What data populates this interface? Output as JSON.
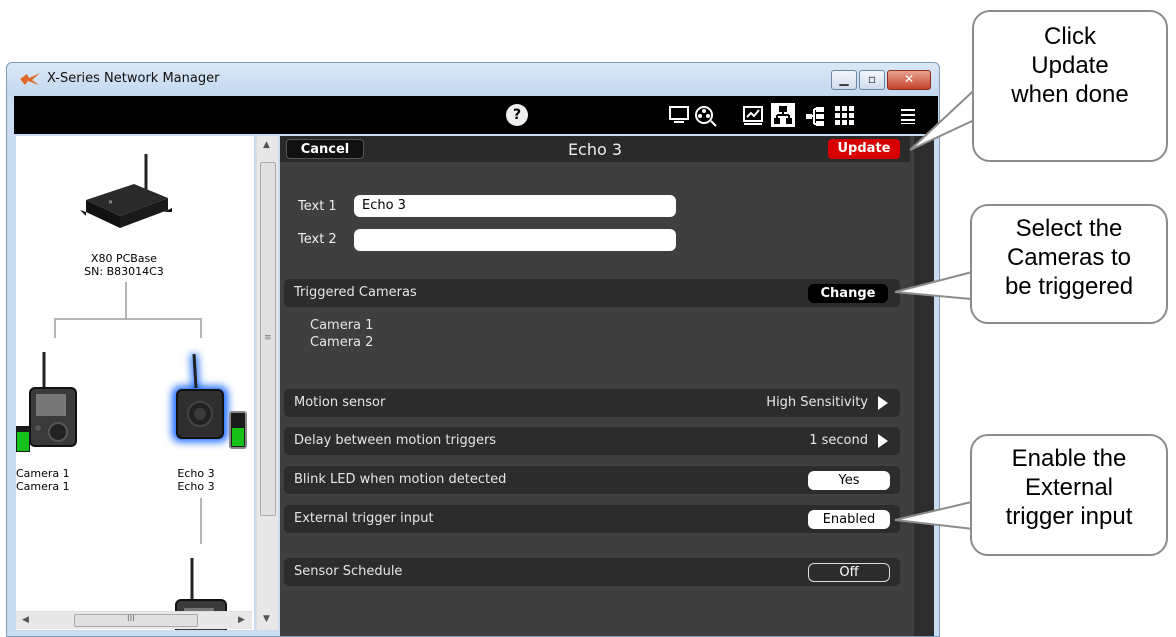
{
  "window": {
    "title": "X-Series Network Manager"
  },
  "toolbar": {
    "help_icon_glyph": "?",
    "icons": [
      "help-icon",
      "monitor-icon",
      "film-reel-icon",
      "chart-icon",
      "network-icon",
      "tree-icon",
      "grid-icon",
      "menu-icon"
    ]
  },
  "tree": {
    "base": {
      "name": "X80 PCBase",
      "serial": "SN: B83014C3"
    },
    "nodes": [
      {
        "line1": "Camera 1",
        "line2": "Camera 1"
      },
      {
        "line1": "Echo 3",
        "line2": "Echo 3"
      }
    ],
    "hscroll_label": "III"
  },
  "panel": {
    "cancel_label": "Cancel",
    "update_label": "Update",
    "title": "Echo 3",
    "text1_label": "Text 1",
    "text1_value": "Echo 3",
    "text2_label": "Text 2",
    "text2_value": "",
    "triggered_label": "Triggered Cameras",
    "change_label": "Change",
    "cameras": [
      "Camera 1",
      "Camera 2"
    ],
    "rows": [
      {
        "label": "Motion sensor",
        "value": "High Sensitivity"
      },
      {
        "label": "Delay between motion triggers",
        "value": "1 second"
      },
      {
        "label": "Blink LED when motion detected",
        "value": "Yes"
      },
      {
        "label": "External trigger input",
        "value": "Enabled"
      },
      {
        "label": "Sensor Schedule",
        "value": "Off"
      }
    ]
  },
  "callouts": {
    "update": [
      "Click",
      "Update",
      "when done"
    ],
    "cameras": [
      "Select the",
      "Cameras to",
      "be triggered"
    ],
    "external": [
      "Enable the",
      "External",
      "trigger input"
    ]
  },
  "colors": {
    "update_red": "#d60000",
    "panel_bg": "#3f3f3f",
    "glow_blue": "#1e6cff"
  }
}
